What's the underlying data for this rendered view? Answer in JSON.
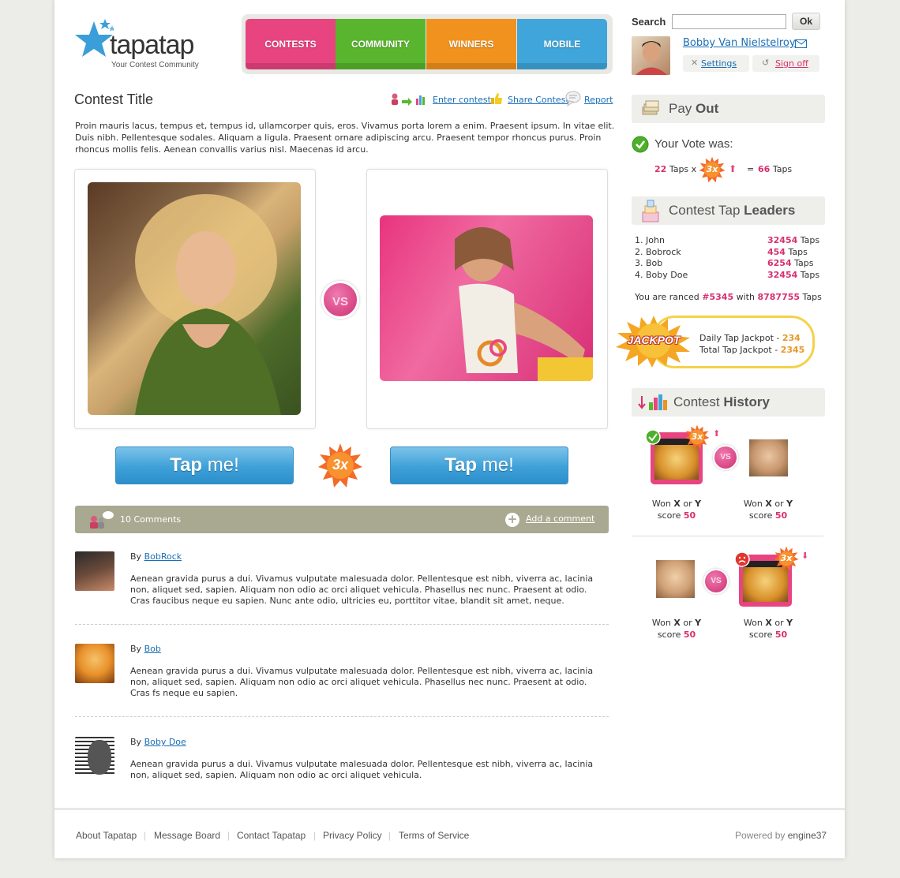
{
  "logo": {
    "name": "tapatap",
    "tagline": "Your Contest Community"
  },
  "nav": [
    {
      "label": "CONTESTS",
      "color": "#e8447f"
    },
    {
      "label": "COMMUNITY",
      "color": "#58b52d"
    },
    {
      "label": "WINNERS",
      "color": "#f0921d"
    },
    {
      "label": "MOBILE",
      "color": "#3fa5da"
    }
  ],
  "search": {
    "label": "Search",
    "button": "Ok",
    "value": ""
  },
  "user": {
    "name": "Bobby Van Nielstelroy",
    "settings": "Settings",
    "signoff": "Sign off"
  },
  "contest": {
    "title": "Contest Title",
    "enter": "Enter contest",
    "share": "Share Contest",
    "report": "Report",
    "description": "Proin mauris lacus, tempus et, tempus id, ullamcorper quis, eros. Vivamus porta lorem a enim. Praesent ipsum. In vitae elit. Duis nibh. Pellentesque sodales. Aliquam a ligula. Praesent ornare adipiscing arcu. Praesent tempor rhoncus purus. Proin rhoncus mollis felis. Aenean convallis varius nisl. Maecenas id arcu.",
    "vs": "VS",
    "tap_strong": "Tap",
    "tap_rest": " me!",
    "multiplier": "3x"
  },
  "comments": {
    "count_label": "10 Comments",
    "add_label": "Add a comment",
    "by": "By",
    "items": [
      {
        "author": "BobRock",
        "text": "Aenean gravida purus a dui. Vivamus vulputate malesuada dolor. Pellentesque est nibh, viverra ac, lacinia non, aliquet sed, sapien. Aliquam non odio ac orci aliquet vehicula. Phasellus nec nunc. Praesent at odio. Cras faucibus neque eu sapien. Nunc ante odio, ultricies eu, porttitor vitae, blandit sit amet, neque."
      },
      {
        "author": "Bob",
        "text": "Aenean gravida purus a dui. Vivamus vulputate malesuada dolor. Pellentesque est nibh, viverra ac, lacinia non, aliquet sed, sapien. Aliquam non odio ac orci aliquet vehicula. Phasellus nec nunc. Praesent at odio. Cras fs neque eu sapien."
      },
      {
        "author": "Boby Doe",
        "text": "Aenean gravida purus a dui. Vivamus vulputate malesuada dolor. Pellentesque est nibh, viverra ac, lacinia non, aliquet sed, sapien. Aliquam non odio ac orci aliquet vehicula."
      }
    ]
  },
  "payout": {
    "title_light": "Pay",
    "title_bold": "Out",
    "vote_label": "Your Vote was:",
    "taps": "22",
    "taps_label": "Taps x",
    "multiplier": "3x",
    "equals": "=",
    "result": "66",
    "result_label": "Taps"
  },
  "leaders": {
    "title_light": "Contest Tap",
    "title_bold": "Leaders",
    "rows": [
      {
        "rank": "1. John",
        "score": "32454",
        "unit": "Taps"
      },
      {
        "rank": "2. Bobrock",
        "score": "454",
        "unit": "Taps"
      },
      {
        "rank": "3. Bob",
        "score": "6254",
        "unit": "Taps"
      },
      {
        "rank": "4. Boby Doe",
        "score": "32454",
        "unit": "Taps"
      }
    ],
    "ranked_prefix": "You are ranced",
    "ranked_pos": "#5345",
    "ranked_mid": "with",
    "ranked_taps": "8787755",
    "ranked_suffix": "Taps"
  },
  "jackpot": {
    "badge": "JACKPOT",
    "daily_label": "Daily Tap Jackpot -",
    "daily_value": "234",
    "total_label": "Total Tap Jackpot -",
    "total_value": "2345"
  },
  "history": {
    "title_light": "Contest",
    "title_bold": "History",
    "multiplier": "3x",
    "vs": "VS",
    "won": "Won",
    "x": "X",
    "or": "or",
    "y": "Y",
    "score_label": "score",
    "score": "50"
  },
  "footer": {
    "links": [
      "About Tapatap",
      "Message Board",
      "Contact Tapatap",
      "Privacy Policy",
      "Terms of Service"
    ],
    "powered_label": "Powered by",
    "powered_name": "engine37"
  }
}
